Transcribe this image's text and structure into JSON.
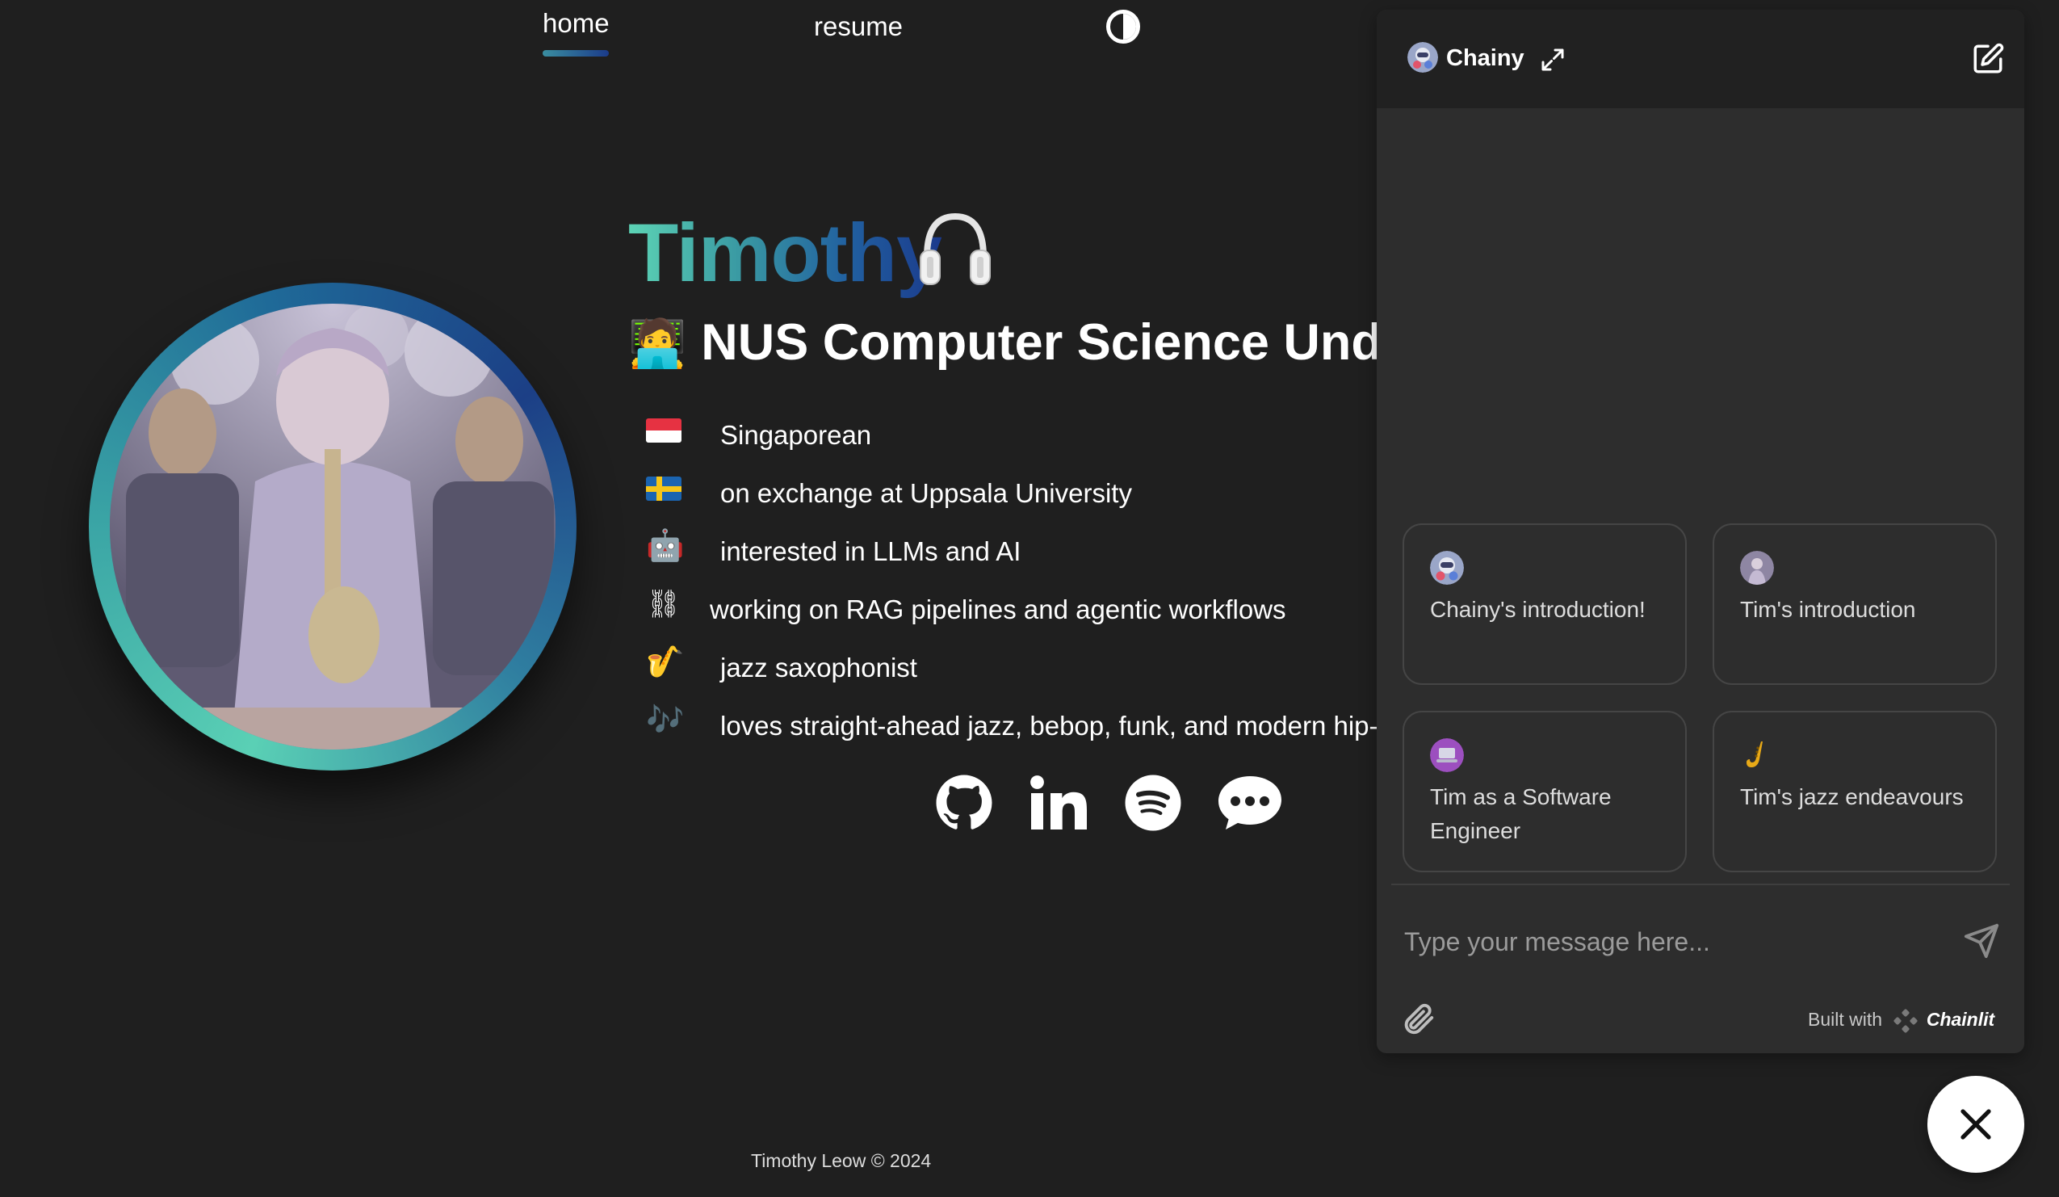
{
  "nav": {
    "home_label": "home",
    "resume_label": "resume",
    "theme_toggle_icon": "contrast-icon"
  },
  "profile": {
    "name": "Timothy",
    "name_emoji": "🎧",
    "headline_emoji": "🧑‍💻",
    "headline": "NUS Computer Science Under",
    "facts": [
      {
        "icon": "singapore-flag-icon",
        "text": "Singaporean"
      },
      {
        "icon": "sweden-flag-icon",
        "text": "on exchange at Uppsala University"
      },
      {
        "icon": "robot-icon",
        "glyph": "🤖",
        "text": "interested in LLMs and AI"
      },
      {
        "icon": "chain-link-icon",
        "glyph": "⛓",
        "text": "working on RAG pipelines and agentic workflows"
      },
      {
        "icon": "saxophone-icon",
        "glyph": "🎷",
        "text": "jazz saxophonist"
      },
      {
        "icon": "music-notes-icon",
        "glyph": "🎶",
        "text": "loves straight-ahead jazz, bebop, funk, and modern hip-ho"
      }
    ],
    "socials": [
      "github-icon",
      "linkedin-icon",
      "spotify-icon",
      "chat-bubble-icon"
    ]
  },
  "footer": {
    "text": "Timothy Leow © 2024"
  },
  "chat": {
    "title": "Chainy",
    "starters": [
      {
        "icon": "chainy-avatar-icon",
        "label": "Chainy's introduction!"
      },
      {
        "icon": "tim-avatar-icon",
        "label": "Tim's introduction"
      },
      {
        "icon": "laptop-icon",
        "label": "Tim as a Software Engineer"
      },
      {
        "icon": "saxophone-icon",
        "label": "Tim's jazz endeavours"
      }
    ],
    "input_placeholder": "Type your message here...",
    "built_with_prefix": "Built with",
    "built_with_brand": "Chainlit"
  },
  "colors": {
    "background": "#1f1f1f",
    "panel": "#2d2d2d",
    "panel_header": "#212121",
    "accent_teal": "#5cd3b5",
    "accent_blue": "#1b3a8c"
  }
}
